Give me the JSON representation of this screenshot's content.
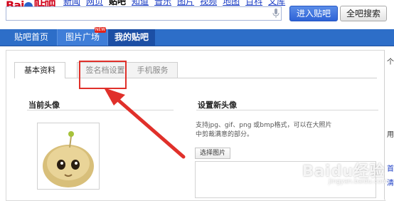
{
  "logo": {
    "text_left": "Bai",
    "text_right": "贴吧"
  },
  "topnav": {
    "links": [
      "新闻",
      "网页",
      "贴吧",
      "知道",
      "音乐",
      "图片",
      "视频",
      "地图",
      "百科",
      "文库"
    ],
    "active_index": 2
  },
  "search": {
    "value": "",
    "enter_label": "进入贴吧",
    "all_label": "全吧搜索"
  },
  "main_tabs": {
    "home": "贴吧首页",
    "pictures": "图片广场",
    "mine": "我的贴吧",
    "new_badge": "NEW"
  },
  "profile_tabs": {
    "basic": "基本资料",
    "signature": "签名档设置",
    "phone": "手机服务"
  },
  "current_avatar": {
    "heading": "当前头像"
  },
  "new_avatar": {
    "heading": "设置新头像",
    "description": "支持jpg、gif、png 或bmp格式，可以在大照片中剪裁满意的部分。",
    "choose_label": "选择图片"
  },
  "sidebar": {
    "top_char": "个",
    "mid_char": "用",
    "link1": "首",
    "link2": "清"
  },
  "watermark": {
    "main": "Baidu经验",
    "sub": "jingyan.baidu.com"
  },
  "colors": {
    "accent_blue": "#2d6ec8",
    "annotation_red": "#e0302a"
  }
}
